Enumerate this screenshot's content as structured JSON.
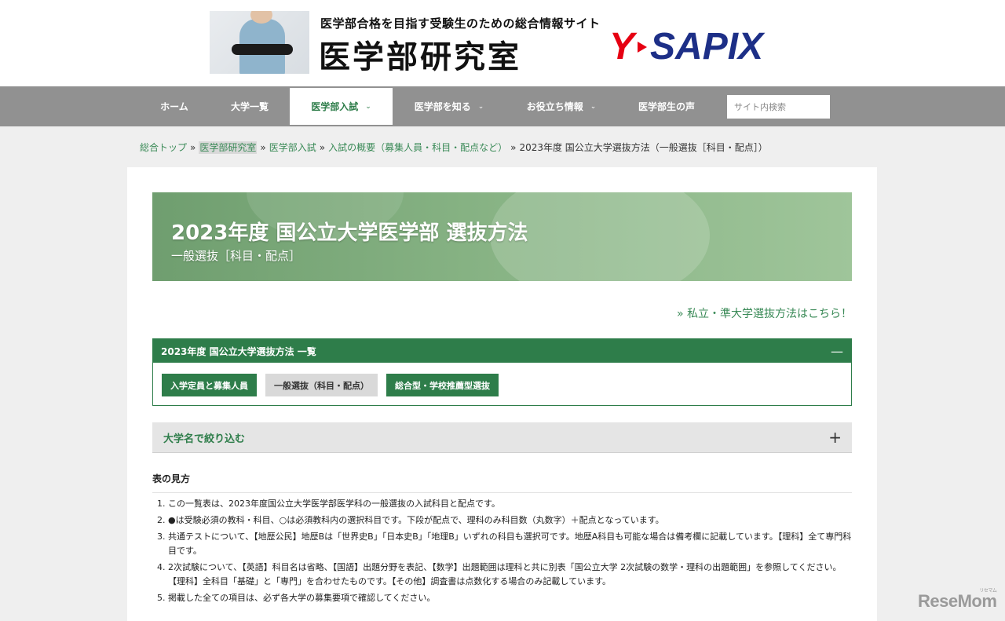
{
  "header": {
    "tagline": "医学部合格を目指す受験生のための総合情報サイト",
    "site_title": "医学部研究室",
    "brand": {
      "y": "Y",
      "rest": "SAPIX"
    }
  },
  "nav": {
    "items": [
      {
        "label": "ホーム",
        "chevron": ""
      },
      {
        "label": "大学一覧",
        "chevron": ""
      },
      {
        "label": "医学部入試",
        "chevron": "⌄"
      },
      {
        "label": "医学部を知る",
        "chevron": "⌄"
      },
      {
        "label": "お役立ち情報",
        "chevron": "⌄"
      },
      {
        "label": "医学部生の声",
        "chevron": ""
      }
    ],
    "search_placeholder": "サイト内検索"
  },
  "breadcrumb": {
    "items": [
      "総合トップ",
      "医学部研究室",
      "医学部入試",
      "入試の概要（募集人員・科目・配点など）"
    ],
    "separator": "»",
    "current": "2023年度 国公立大学選抜方法（一般選抜［科目・配点］）"
  },
  "banner": {
    "title": "2023年度 国公立大学医学部 選抜方法",
    "subtitle": "一般選抜［科目・配点］"
  },
  "private_link": "» 私立・準大学選抜方法はこちら！",
  "list_panel": {
    "title": "2023年度 国公立大学選抜方法 一覧",
    "toggle": "—",
    "buttons": [
      "入学定員と募集人員",
      "一般選抜（科目・配点）",
      "総合型・学校推薦型選抜"
    ]
  },
  "filter": {
    "label": "大学名で絞り込む",
    "toggle": "+"
  },
  "legend": {
    "heading": "表の見方",
    "notes": [
      "この一覧表は、2023年度国公立大学医学部医学科の一般選抜の入試科目と配点です。",
      "●は受験必須の教科・科目、○は必須教科内の選択科目です。下段が配点で、理科のみ科目数（丸数字）＋配点となっています。",
      "共通テストについて、【地歴公民】地歴Bは「世界史B」「日本史B」「地理B」いずれの科目も選択可です。地歴A科目も可能な場合は備考欄に記載しています。【理科】全て専門科目です。",
      "2次試験について、【英語】科目名は省略、【国語】出題分野を表記、【数学】出題範囲は理科と共に別表「国公立大学 2次試験の数学・理科の出題範囲」を参照してください。【理科】全科目「基礎」と「専門」を合わせたものです。【その他】調査書は点数化する場合のみ記載しています。",
      "掲載した全ての項目は、必ず各大学の募集要項で確認してください。"
    ]
  },
  "watermark": {
    "text": "ReseMom",
    "sub": "リセマム"
  },
  "colors": {
    "accent_green": "#2e7d4a",
    "nav_grey": "#919191",
    "brand_red": "#e60012",
    "brand_blue": "#1d2f87"
  }
}
